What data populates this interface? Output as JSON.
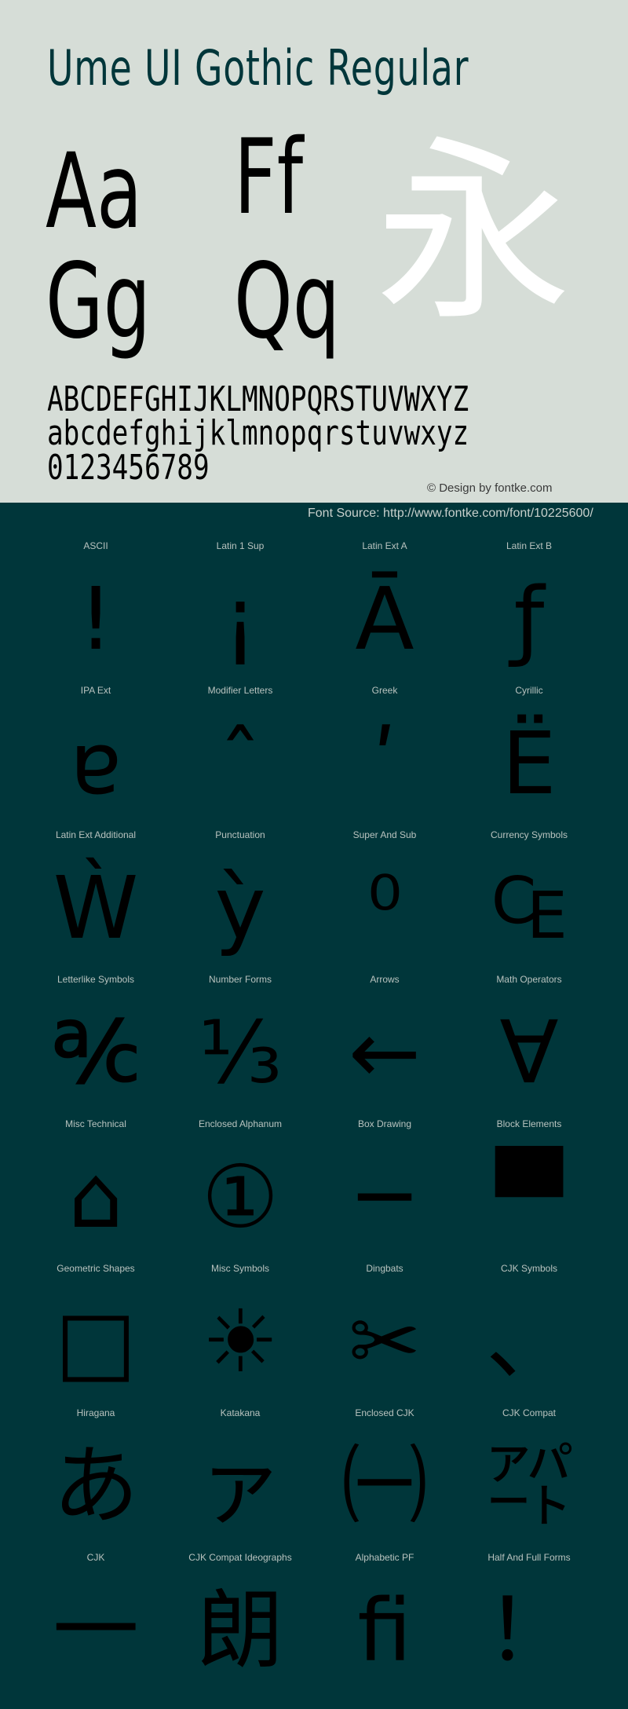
{
  "header": {
    "title": "Ume UI Gothic Regular",
    "specimen_pairs": [
      "Aa",
      "Ff",
      "Gg",
      "Qq"
    ],
    "specimen_kanji": "永",
    "uppercase": "ABCDEFGHIJKLMNOPQRSTUVWXYZ",
    "lowercase": "abcdefghijklmnopqrstuvwxyz",
    "digits": "0123456789",
    "credit": "© Design by fontke.com"
  },
  "source": "Font Source: http://www.fontke.com/font/10225600/",
  "colors": {
    "top_background": "#d6ddd7",
    "bottom_background": "#00363a",
    "title": "#00363a",
    "kanji": "#ffffff",
    "glyph": "#000000",
    "label": "#b9c3bf"
  },
  "blocks": [
    {
      "label": "ASCII",
      "glyph": "!"
    },
    {
      "label": "Latin 1 Sup",
      "glyph": "¡"
    },
    {
      "label": "Latin Ext A",
      "glyph": "Ā"
    },
    {
      "label": "Latin Ext B",
      "glyph": "ƒ"
    },
    {
      "label": "IPA Ext",
      "glyph": "ɐ"
    },
    {
      "label": "Modifier Letters",
      "glyph": "ˆ"
    },
    {
      "label": "Greek",
      "glyph": "ʹ"
    },
    {
      "label": "Cyrillic",
      "glyph": "Ё"
    },
    {
      "label": "Latin Ext Additional",
      "glyph": "Ẁ"
    },
    {
      "label": "Punctuation",
      "glyph": "ỳ"
    },
    {
      "label": "Super And Sub",
      "glyph": "⁰"
    },
    {
      "label": "Currency Symbols",
      "glyph": "₠"
    },
    {
      "label": "Letterlike Symbols",
      "glyph": "℀"
    },
    {
      "label": "Number Forms",
      "glyph": "⅓"
    },
    {
      "label": "Arrows",
      "glyph": "←"
    },
    {
      "label": "Math Operators",
      "glyph": "∀"
    },
    {
      "label": "Misc Technical",
      "glyph": "⌂"
    },
    {
      "label": "Enclosed Alphanum",
      "glyph": "①"
    },
    {
      "label": "Box Drawing",
      "glyph": "─"
    },
    {
      "label": "Block Elements",
      "glyph": "▀"
    },
    {
      "label": "Geometric Shapes",
      "glyph": "□"
    },
    {
      "label": "Misc Symbols",
      "glyph": "☀"
    },
    {
      "label": "Dingbats",
      "glyph": "✂"
    },
    {
      "label": "CJK Symbols",
      "glyph": "、"
    },
    {
      "label": "Hiragana",
      "glyph": "あ"
    },
    {
      "label": "Katakana",
      "glyph": "ァ"
    },
    {
      "label": "Enclosed CJK",
      "glyph": "㈠"
    },
    {
      "label": "CJK Compat",
      "glyph": "㌀"
    },
    {
      "label": "CJK",
      "glyph": "一"
    },
    {
      "label": "CJK Compat Ideographs",
      "glyph": "朗"
    },
    {
      "label": "Alphabetic PF",
      "glyph": "ﬁ"
    },
    {
      "label": "Half And Full Forms",
      "glyph": "！"
    }
  ]
}
